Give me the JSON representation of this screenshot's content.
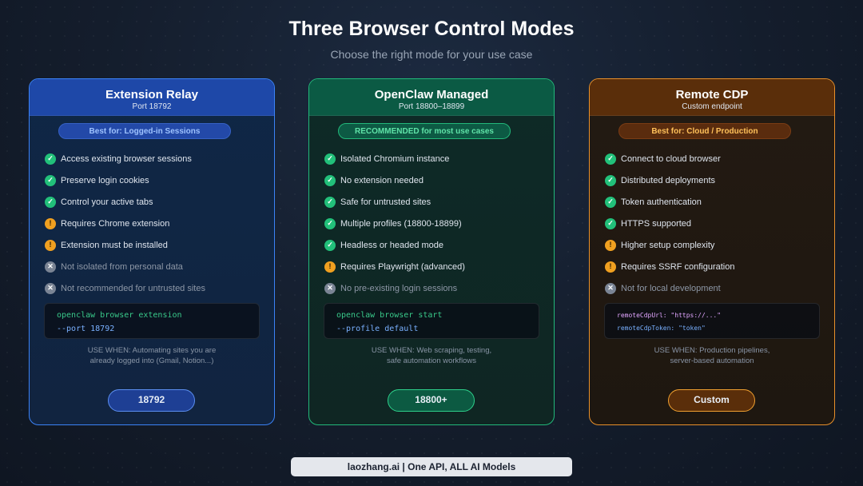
{
  "header": {
    "title": "Three Browser Control Modes",
    "subtitle": "Choose the right mode for your use case"
  },
  "cards": [
    {
      "name": "Extension Relay",
      "port": "Port 18792",
      "badge": "Best for: Logged-in Sessions",
      "features": [
        {
          "icon": "check-icon",
          "text": "Access existing browser sessions"
        },
        {
          "icon": "check-icon",
          "text": "Preserve login cookies"
        },
        {
          "icon": "check-icon",
          "text": "Control your active tabs"
        },
        {
          "icon": "warning-icon",
          "text": "Requires Chrome extension"
        },
        {
          "icon": "warning-icon",
          "text": "Extension must be installed"
        },
        {
          "icon": "cross-icon",
          "text": "Not isolated from personal data"
        },
        {
          "icon": "cross-icon",
          "text": "Not recommended for untrusted sites"
        }
      ],
      "code": [
        "openclaw browser extension",
        "--port 18792"
      ],
      "use_when": [
        "USE WHEN: Automating sites you are",
        "already logged into (Gmail, Notion...)"
      ],
      "button": "18792",
      "accent": "#3b82f6"
    },
    {
      "name": "OpenClaw Managed",
      "port": "Port 18800–18899",
      "badge": "RECOMMENDED for most use cases",
      "features": [
        {
          "icon": "check-icon",
          "text": "Isolated Chromium instance"
        },
        {
          "icon": "check-icon",
          "text": "No extension needed"
        },
        {
          "icon": "check-icon",
          "text": "Safe for untrusted sites"
        },
        {
          "icon": "check-icon",
          "text": "Multiple profiles (18800-18899)"
        },
        {
          "icon": "check-icon",
          "text": "Headless or headed mode"
        },
        {
          "icon": "warning-icon",
          "text": "Requires Playwright (advanced)"
        },
        {
          "icon": "cross-icon",
          "text": "No pre-existing login sessions"
        }
      ],
      "code": [
        "openclaw browser start",
        "--profile default"
      ],
      "use_when": [
        "USE WHEN: Web scraping, testing,",
        "safe automation workflows"
      ],
      "button": "18800+",
      "accent": "#22b87a"
    },
    {
      "name": "Remote CDP",
      "port": "Custom endpoint",
      "badge": "Best for: Cloud / Production",
      "features": [
        {
          "icon": "check-icon",
          "text": "Connect to cloud browser"
        },
        {
          "icon": "check-icon",
          "text": "Distributed deployments"
        },
        {
          "icon": "check-icon",
          "text": "Token authentication"
        },
        {
          "icon": "check-icon",
          "text": "HTTPS supported"
        },
        {
          "icon": "warning-icon",
          "text": "Higher setup complexity"
        },
        {
          "icon": "warning-icon",
          "text": "Requires SSRF configuration"
        },
        {
          "icon": "cross-icon",
          "text": "Not for local development"
        }
      ],
      "code": [
        "remoteCdpUrl: \"https://...\"",
        "remoteCdpToken: \"token\""
      ],
      "use_when": [
        "USE WHEN: Production pipelines,",
        "server-based automation"
      ],
      "button": "Custom",
      "accent": "#e8902a"
    }
  ],
  "footer": "laozhang.ai | One API, ALL AI Models"
}
